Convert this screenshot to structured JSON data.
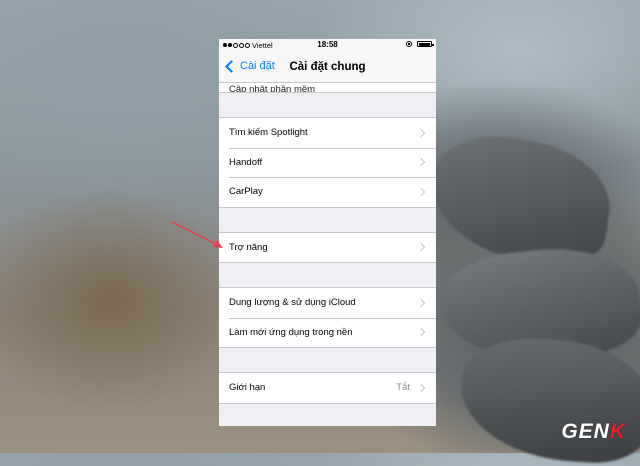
{
  "status_bar": {
    "carrier": "Viettel",
    "time": "18:58",
    "signal_bars": 5,
    "signal_filled": 2,
    "battery_level": 0.95
  },
  "nav": {
    "back_label": "Cài đặt",
    "title": "Cài đặt chung"
  },
  "groups": [
    {
      "items": [
        {
          "label": "Cập nhật phần mềm",
          "value": ""
        }
      ]
    },
    {
      "items": [
        {
          "label": "Tìm kiếm Spotlight",
          "value": ""
        },
        {
          "label": "Handoff",
          "value": ""
        },
        {
          "label": "CarPlay",
          "value": ""
        }
      ]
    },
    {
      "items": [
        {
          "label": "Trợ năng",
          "value": ""
        }
      ]
    },
    {
      "items": [
        {
          "label": "Dung lượng & sử dụng iCloud",
          "value": ""
        },
        {
          "label": "Làm mới ứng dụng trong nền",
          "value": ""
        }
      ]
    },
    {
      "items": [
        {
          "label": "Giới hạn",
          "value": "Tắt"
        }
      ]
    }
  ],
  "watermark": {
    "part1": "GEN",
    "part2": "K"
  },
  "colors": {
    "accent": "#007aff",
    "annotation_arrow": "#e0454e"
  }
}
